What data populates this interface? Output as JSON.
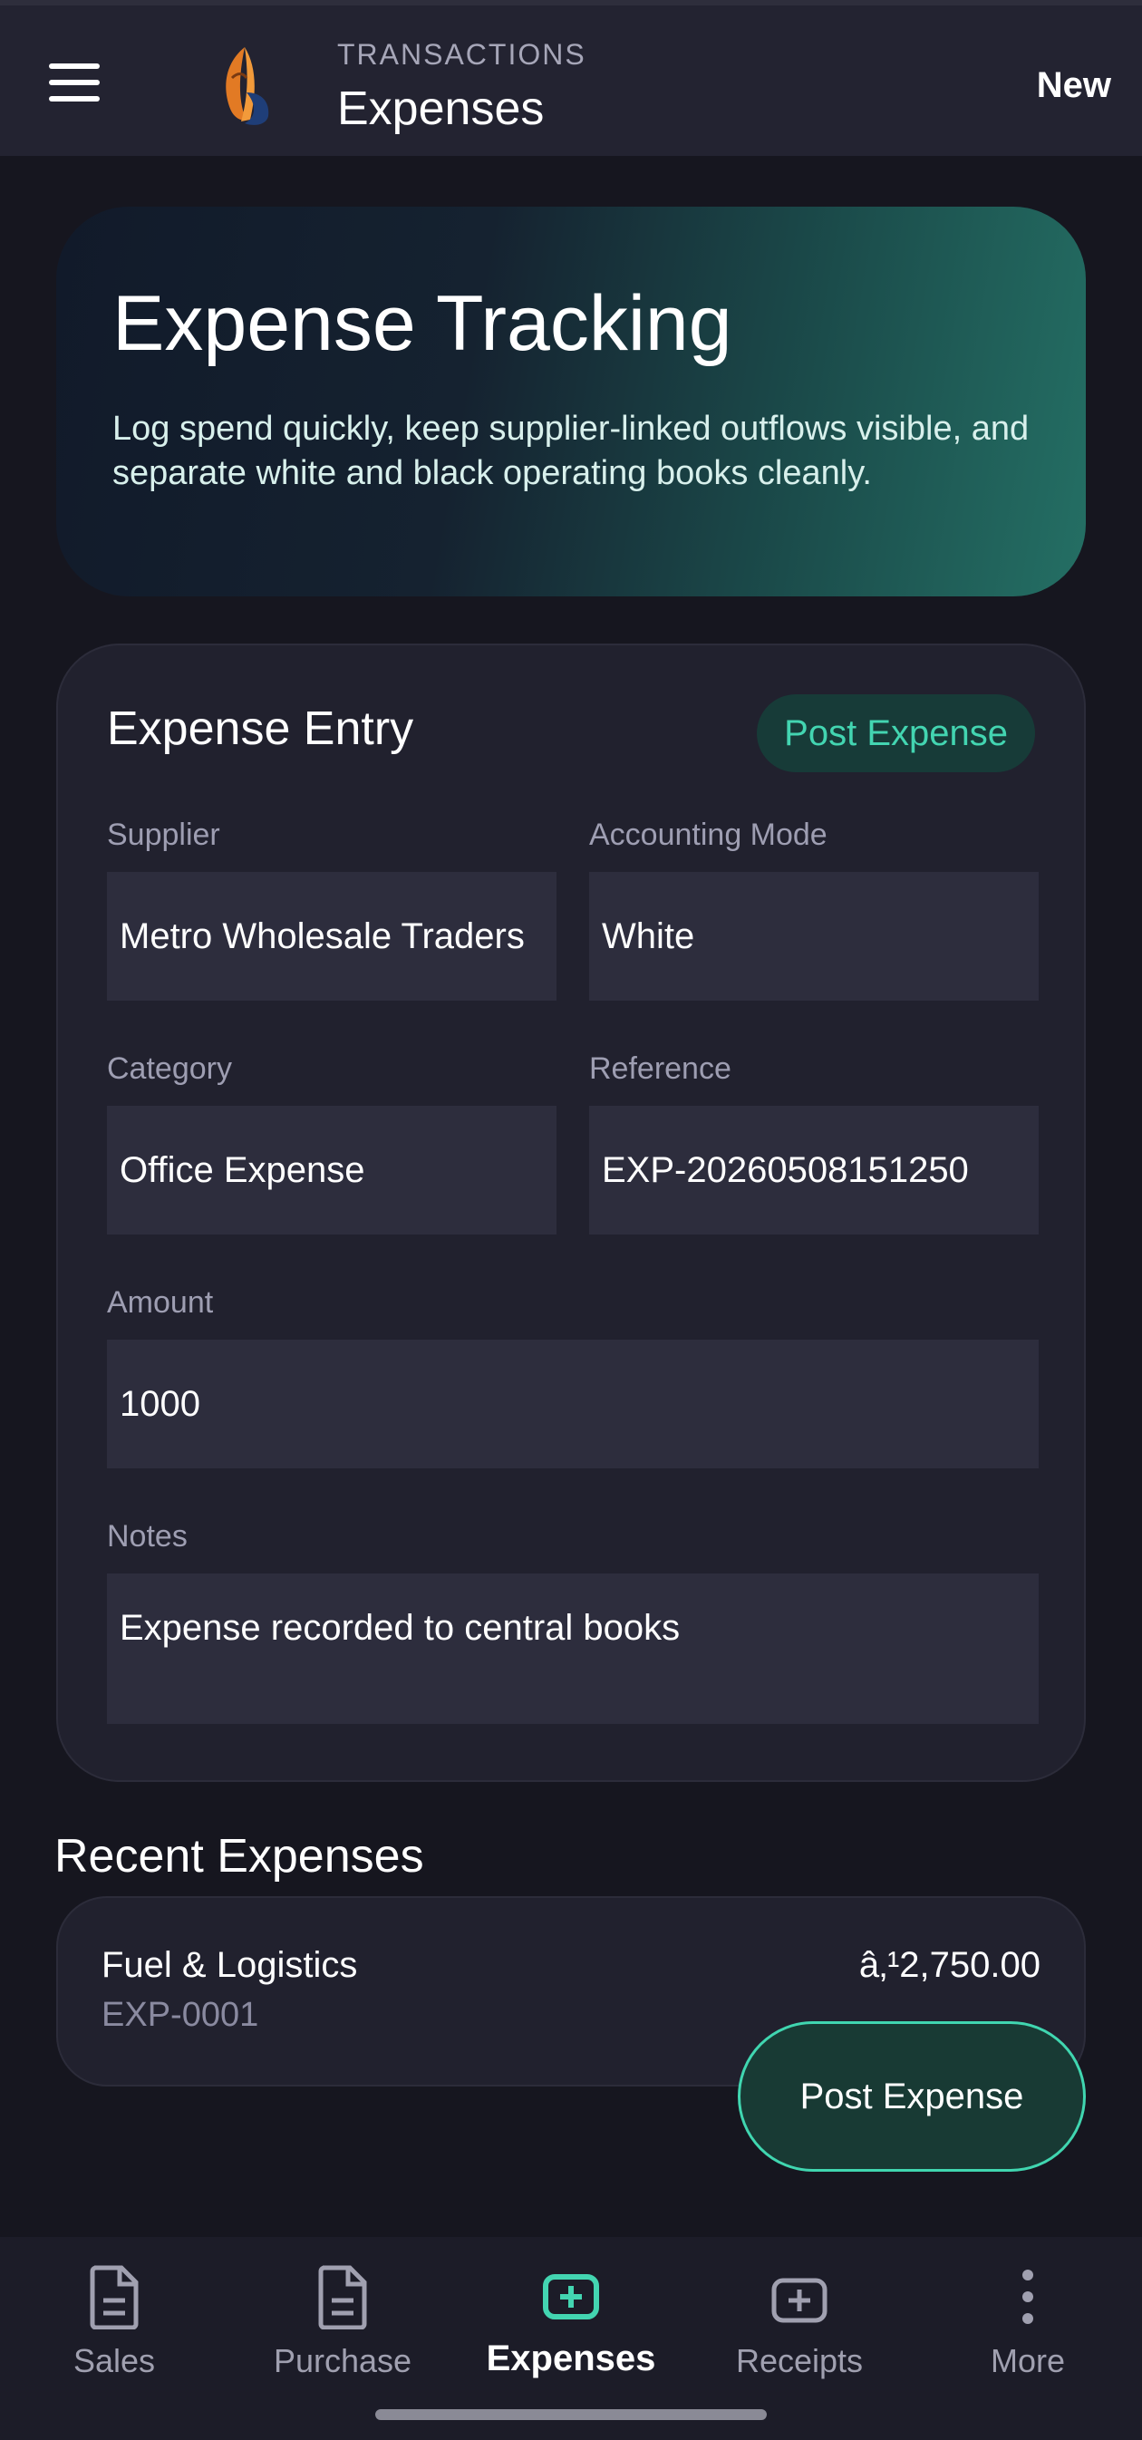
{
  "header": {
    "kicker": "TRANSACTIONS",
    "title": "Expenses",
    "new_label": "New",
    "icons": [
      "menu-icon",
      "app-logo-icon"
    ]
  },
  "hero": {
    "title": "Expense Tracking",
    "description": "Log spend quickly, keep supplier-linked outflows visible, and separate white and black operating books cleanly."
  },
  "form": {
    "title": "Expense Entry",
    "post_badge": "Post Expense",
    "supplier": {
      "label": "Supplier",
      "value": "Metro Wholesale Traders"
    },
    "mode": {
      "label": "Accounting Mode",
      "value": "White"
    },
    "category": {
      "label": "Category",
      "value": "Office Expense"
    },
    "reference": {
      "label": "Reference",
      "value": "EXP-20260508151250"
    },
    "amount": {
      "label": "Amount",
      "value": "1000"
    },
    "notes": {
      "label": "Notes",
      "value": "Expense recorded to central books"
    }
  },
  "recent": {
    "title": "Recent Expenses",
    "items": [
      {
        "name": "Fuel & Logistics",
        "ref": "EXP-0001",
        "amount": "â‚¹2,750.00"
      }
    ]
  },
  "fab": {
    "label": "Post Expense"
  },
  "nav": {
    "items": [
      {
        "label": "Sales",
        "icon": "document-icon"
      },
      {
        "label": "Purchase",
        "icon": "document-icon"
      },
      {
        "label": "Expenses",
        "icon": "plus-box-icon",
        "active": true
      },
      {
        "label": "Receipts",
        "icon": "plus-box-icon"
      },
      {
        "label": "More",
        "icon": "more-vertical-icon"
      }
    ]
  },
  "colors": {
    "background": "#16161f",
    "surface": "#21212e",
    "field": "#2d2d3d",
    "accent": "#43d5b1",
    "accent_bg": "#173b38"
  }
}
